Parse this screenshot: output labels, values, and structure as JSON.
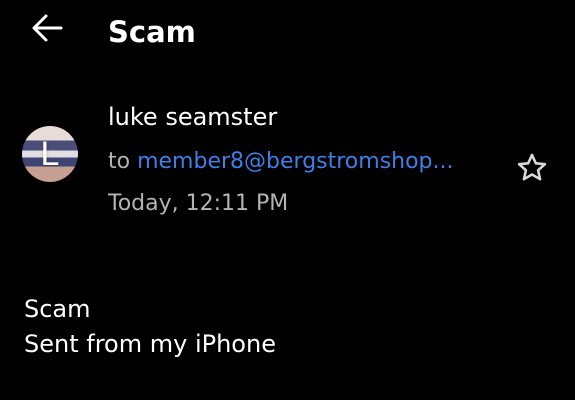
{
  "header": {
    "title": "Scam",
    "back_icon": "arrow-left-icon"
  },
  "email": {
    "sender_name": "luke seamster",
    "avatar_initial": "L",
    "to_label": "to",
    "to_address": "member8@bergstromshop...",
    "timestamp": "Today, 12:11 PM",
    "star_icon": "star-outline-icon",
    "body_lines": [
      "Scam",
      "Sent from my iPhone"
    ]
  },
  "colors": {
    "background": "#000000",
    "text_primary": "#ffffff",
    "text_secondary": "#b3b3b3",
    "link": "#3d7fe6"
  }
}
